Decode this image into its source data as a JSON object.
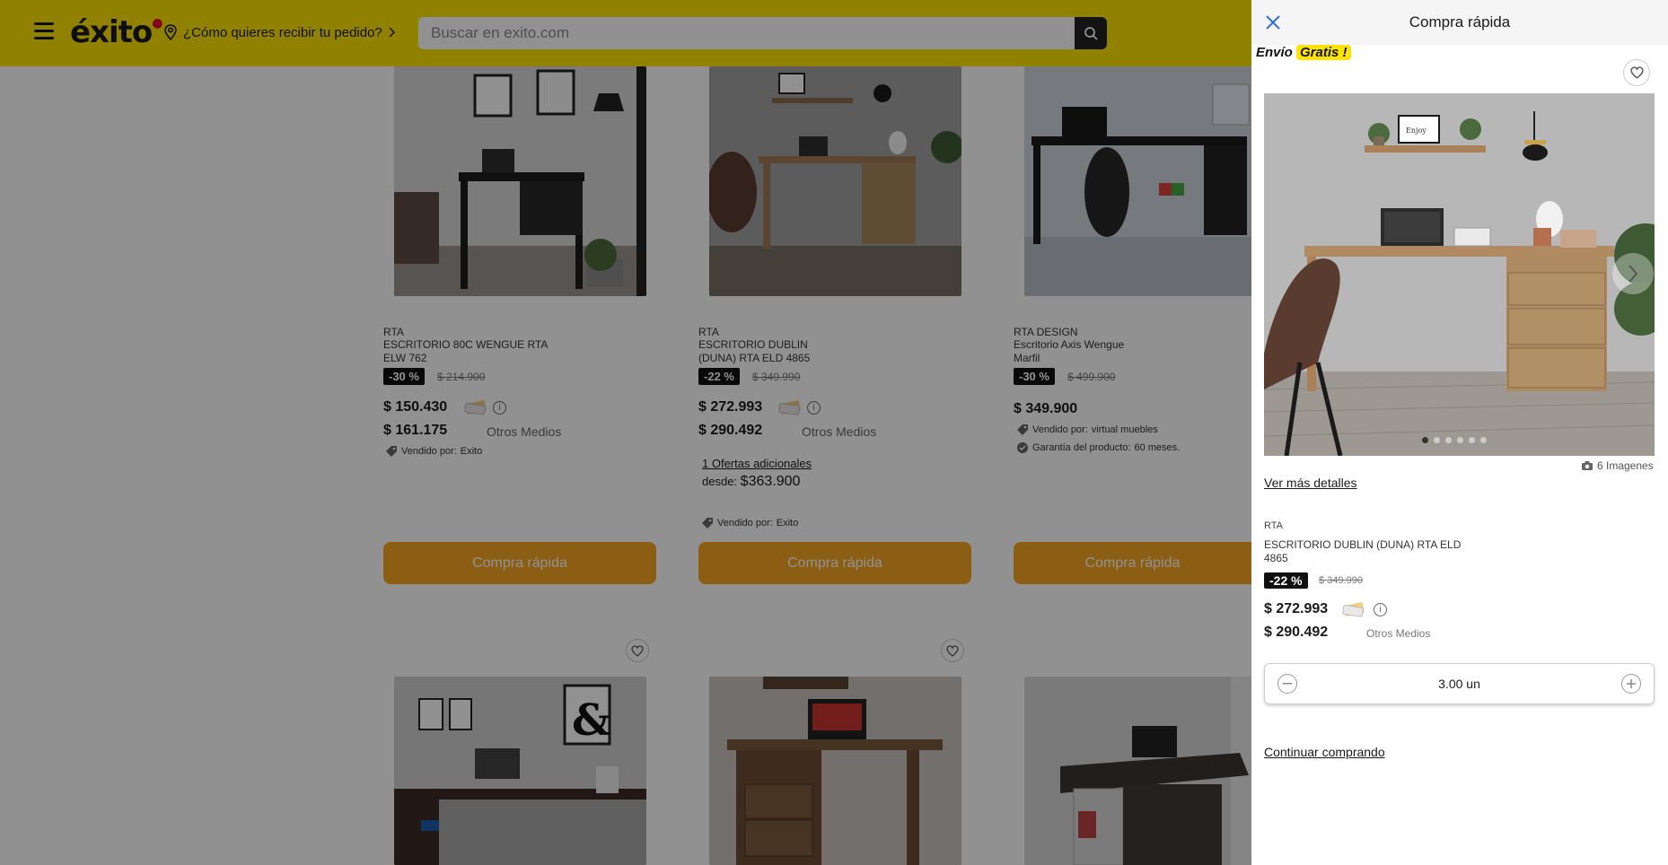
{
  "header": {
    "logo": "éxito",
    "delivery_prompt": "¿Cómo quieres recibir tu pedido?",
    "search_placeholder": "Buscar en exito.com",
    "bg_color": "#fde400"
  },
  "products_row1": [
    {
      "brand": "RTA",
      "name": "ESCRITORIO 80C WENGUE RTA ELW 762",
      "discount": "-30 %",
      "old_price": "$ 214.900",
      "price": "$ 150.430",
      "price_other": "$ 161.175",
      "other_label": "Otros Medios",
      "seller_label": "Vendido por:",
      "seller": "Exito",
      "button": "Compra rápida"
    },
    {
      "brand": "RTA",
      "name": "ESCRITORIO DUBLIN (DUNA) RTA ELD 4865",
      "discount": "-22 %",
      "old_price": "$ 349.990",
      "price": "$ 272.993",
      "price_other": "$ 290.492",
      "other_label": "Otros Medios",
      "offers": "1 Ofertas adicionales",
      "desde_label": "desde:",
      "desde_price": "$363.900",
      "seller_label": "Vendido por:",
      "seller": "Exito",
      "button": "Compra rápida"
    },
    {
      "brand": "RTA DESIGN",
      "name": "Escritorio Axis Wengue Marfil",
      "discount": "-30 %",
      "old_price": "$ 499.900",
      "price": "$ 349.900",
      "seller_label": "Vendido por:",
      "seller": "virtual muebles",
      "warranty_label": "Garantía del producto:",
      "warranty": "60 meses.",
      "button": "Compra rápida"
    }
  ],
  "drawer": {
    "title": "Compra rápida",
    "envio": "Envío",
    "gratis": "Gratis",
    "bang": "!",
    "image_count": "6 Imagenes",
    "ver_mas": "Ver más detalles",
    "brand": "RTA",
    "name": "ESCRITORIO DUBLIN (DUNA) RTA ELD 4865",
    "discount": "-22 %",
    "old_price": "$ 349.990",
    "price": "$ 272.993",
    "price_other": "$ 290.492",
    "other_label": "Otros Medios",
    "quantity": "3.00 un",
    "continuar": "Continuar comprando",
    "carousel_total_dots": 6,
    "carousel_active_dot": 1
  },
  "colors": {
    "accent_yellow": "#fde400",
    "button_orange": "#f5a623",
    "overlay": "rgba(0,0,0,0.43)"
  }
}
